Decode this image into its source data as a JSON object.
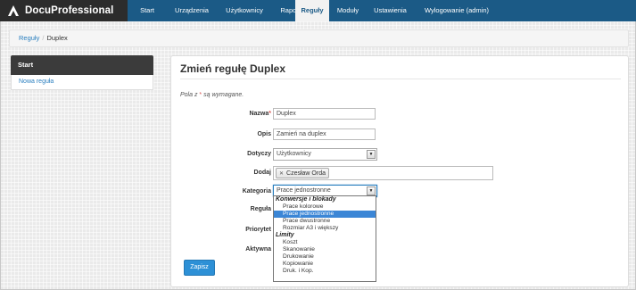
{
  "brand": {
    "name": "DocuProfessional",
    "logo_icon": "docuprofessional-logo-icon"
  },
  "nav": {
    "items": [
      "Start",
      "Urządzenia",
      "Użytkownicy",
      "Raporty",
      "Reguły",
      "Moduły",
      "Ustawienia",
      "Wylogowanie (admin)"
    ],
    "active": "Reguły"
  },
  "breadcrumb": {
    "parent": "Reguły",
    "separator": "/",
    "current": "Duplex"
  },
  "sidebar": {
    "heading": "Start",
    "link": "Nowa reguła"
  },
  "form": {
    "title": "Zmień regułę Duplex",
    "required_note_prefix": "Pola z",
    "required_star": "*",
    "required_note_suffix": "są wymagane.",
    "fields": {
      "nazwa": {
        "label": "Nazwa",
        "value": "Duplex"
      },
      "opis": {
        "label": "Opis",
        "value": "Zamień na duplex"
      },
      "dotyczy": {
        "label": "Dotyczy",
        "value": "Użytkownicy"
      },
      "dodaj": {
        "label": "Dodaj",
        "tag": "Czesław Orda"
      },
      "kategoria": {
        "label": "Kategoria",
        "value": "Prace jednostronne"
      },
      "regula": {
        "label": "Reguła"
      },
      "priorytet": {
        "label": "Priorytet"
      },
      "aktywna": {
        "label": "Aktywna"
      }
    },
    "save_label": "Zapisz"
  },
  "dropdown": {
    "groups": [
      {
        "label": "Konwersje i blokady",
        "options": [
          "Prace kolorowe",
          "Prace jednostronne",
          "Prace dwustronne",
          "Rozmiar A3 i większy"
        ]
      },
      {
        "label": "Limity",
        "options": [
          "Koszt",
          "Skanowanie",
          "Drukowanie",
          "Kopiowanie",
          "Druk. i Kop."
        ]
      }
    ],
    "selected": "Prace jednostronne"
  },
  "colors": {
    "navbar": "#1b5a86",
    "brand_bg": "#2c2c2c",
    "accent": "#2d90d6",
    "selected_option": "#3b86d6"
  }
}
